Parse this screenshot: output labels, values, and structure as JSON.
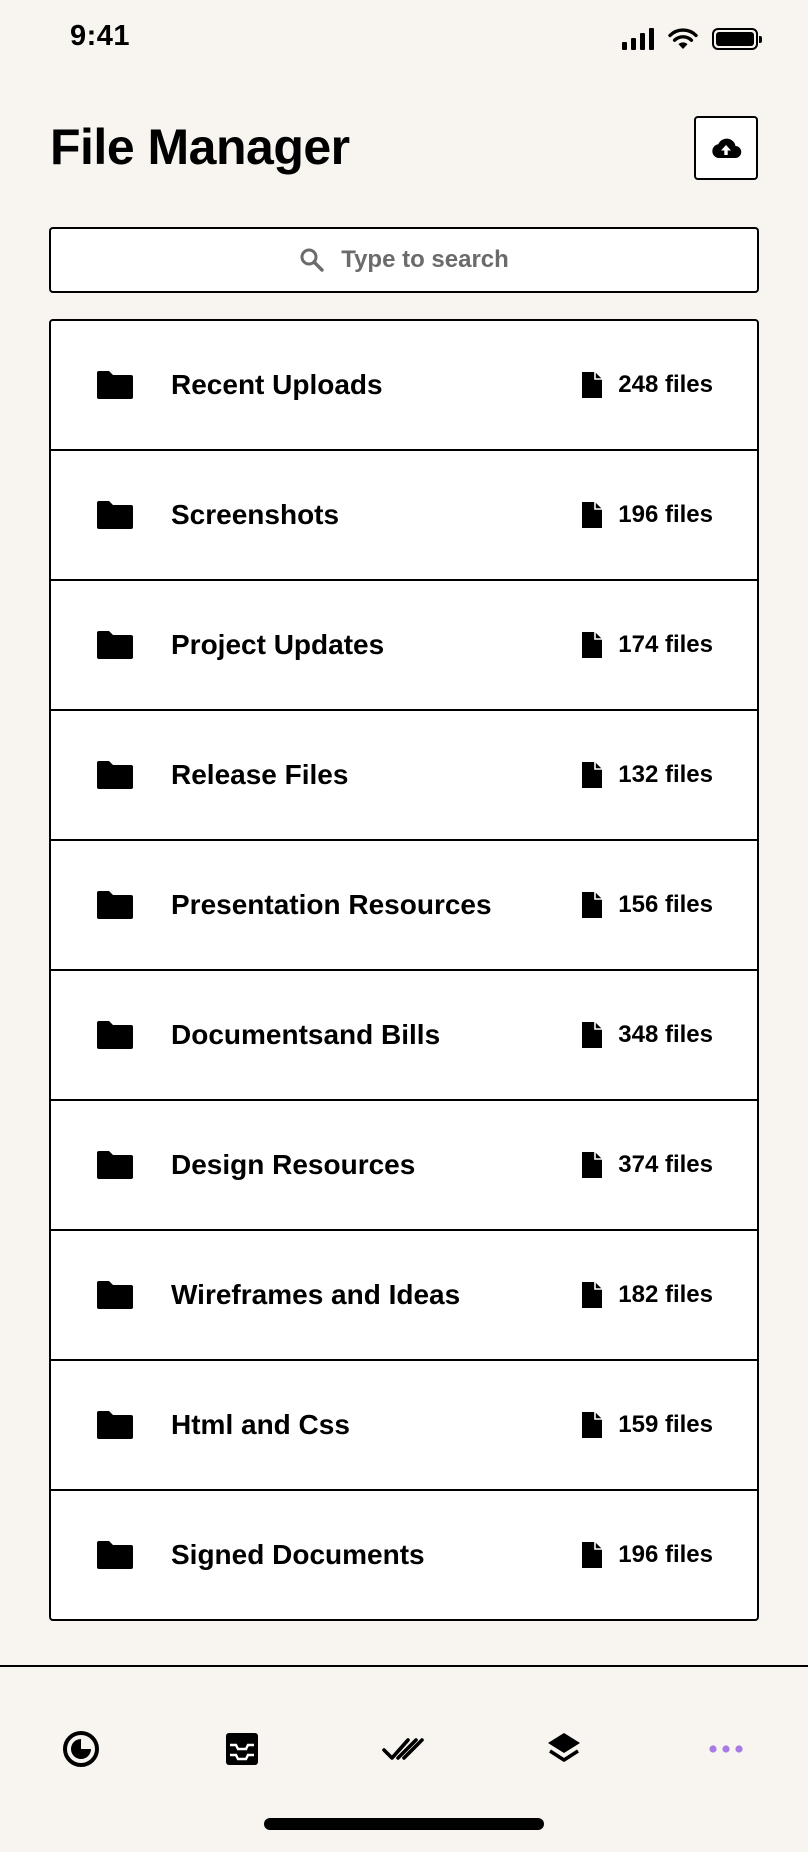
{
  "status_bar": {
    "time": "9:41"
  },
  "header": {
    "title": "File Manager",
    "upload_icon": "cloud-upload-icon"
  },
  "search": {
    "placeholder": "Type to search"
  },
  "folders": [
    {
      "name": "Recent Uploads",
      "count": "248 files"
    },
    {
      "name": "Screenshots",
      "count": "196 files"
    },
    {
      "name": "Project Updates",
      "count": "174 files"
    },
    {
      "name": "Release Files",
      "count": "132 files"
    },
    {
      "name": "Presentation Resources",
      "count": "156 files"
    },
    {
      "name": "Documentsand Bills",
      "count": "348 files"
    },
    {
      "name": "Design Resources",
      "count": "374 files"
    },
    {
      "name": "Wireframes and Ideas",
      "count": "182 files"
    },
    {
      "name": "Html and Css",
      "count": "159 files"
    },
    {
      "name": "Signed Documents",
      "count": "196 files"
    }
  ],
  "tab_bar": {
    "items": [
      {
        "icon": "pie-chart-icon"
      },
      {
        "icon": "inbox-icon"
      },
      {
        "icon": "double-check-icon"
      },
      {
        "icon": "layers-icon"
      },
      {
        "icon": "more-icon",
        "active": true
      }
    ],
    "active_color": "#a77be6"
  },
  "colors": {
    "background": "#f8f4f0",
    "surface": "#ffffff",
    "text": "#000000",
    "placeholder": "#6b6b6b"
  }
}
